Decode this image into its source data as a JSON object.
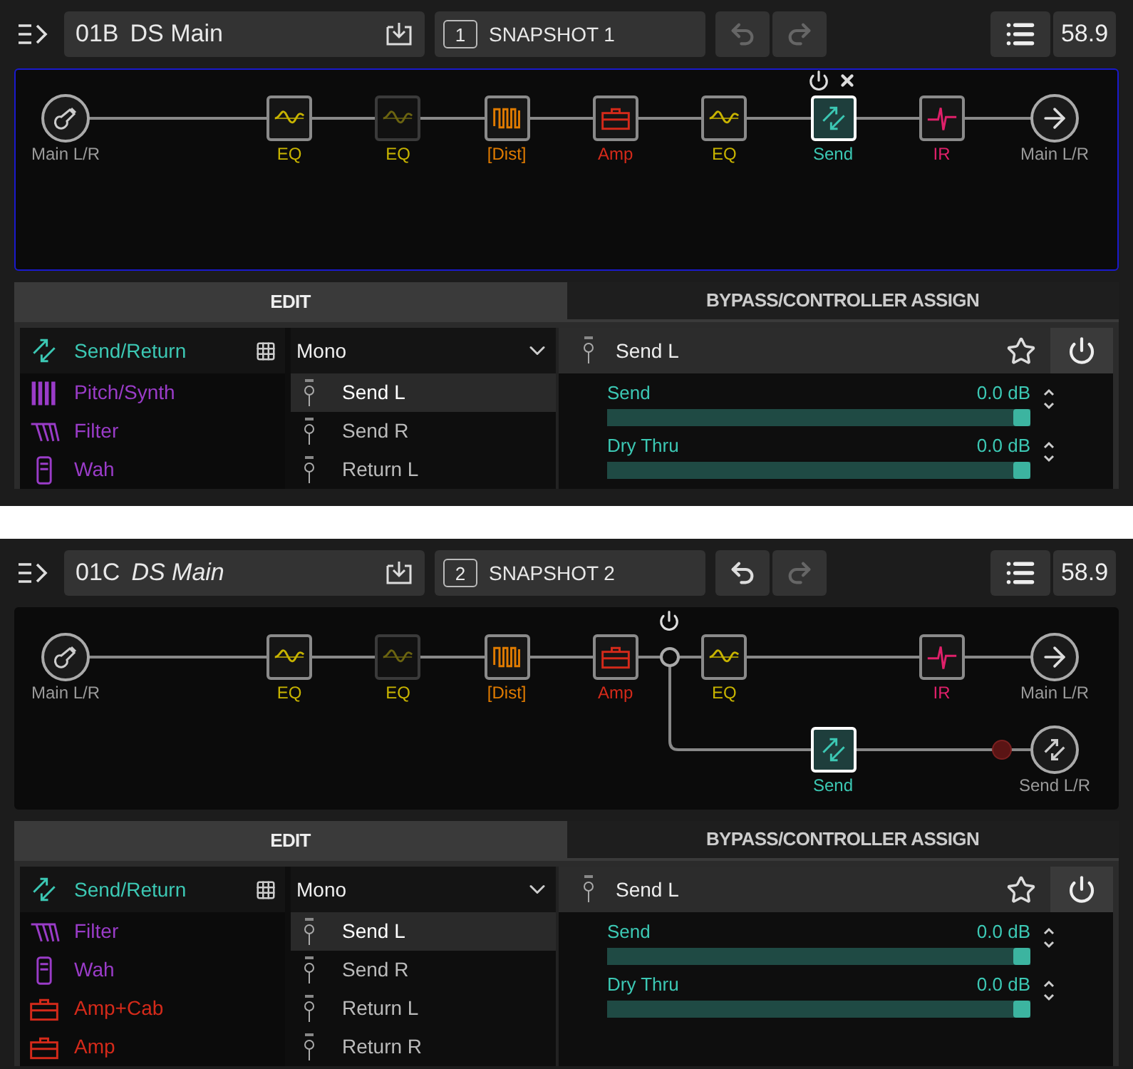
{
  "panels": [
    {
      "focused": true,
      "split": false,
      "header": {
        "preset_number": "01B",
        "preset_name": "DS Main",
        "edited": false,
        "snapshot_number": "1",
        "snapshot_label": "SNAPSHOT 1",
        "undo_enabled": false,
        "redo_enabled": false,
        "tempo": "58.9"
      },
      "chain": {
        "input": "Main L/R",
        "output": "Main L/R",
        "blocks": [
          {
            "kind": "eq",
            "label": "EQ",
            "color": "#c8b400",
            "bypassed": false,
            "selected": false
          },
          {
            "kind": "eq",
            "label": "EQ",
            "color": "#c8b400",
            "bypassed": true,
            "selected": false
          },
          {
            "kind": "dist",
            "label": "[Dist]",
            "color": "#e07b00",
            "bypassed": false,
            "selected": false
          },
          {
            "kind": "amp",
            "label": "Amp",
            "color": "#d42a1a",
            "bypassed": false,
            "selected": false
          },
          {
            "kind": "eq",
            "label": "EQ",
            "color": "#c8b400",
            "bypassed": false,
            "selected": false
          },
          {
            "kind": "send",
            "label": "Send",
            "color": "#3cc8b4",
            "bypassed": false,
            "selected": true
          },
          {
            "kind": "ir",
            "label": "IR",
            "color": "#e0206a",
            "bypassed": false,
            "selected": false
          }
        ]
      },
      "edit": {
        "tabs": [
          {
            "label": "EDIT",
            "selected": true
          },
          {
            "label": "BYPASS/CONTROLLER ASSIGN",
            "selected": false
          }
        ],
        "categories": [
          {
            "kind": "send",
            "label": "Send/Return",
            "color": "#3cc8b4",
            "selected": true
          },
          {
            "kind": "pitch",
            "label": "Pitch/Synth",
            "color": "#9a3cc8",
            "selected": false
          },
          {
            "kind": "filter",
            "label": "Filter",
            "color": "#9a3cc8",
            "selected": false
          },
          {
            "kind": "wah",
            "label": "Wah",
            "color": "#9a3cc8",
            "selected": false
          }
        ],
        "mode": "Mono",
        "models": [
          {
            "label": "Send L",
            "selected": true
          },
          {
            "label": "Send R",
            "selected": false
          },
          {
            "label": "Return L",
            "selected": false
          }
        ],
        "model_title": "Send L",
        "params": [
          {
            "label": "Send",
            "value": "0.0 dB",
            "level": 1
          },
          {
            "label": "Dry Thru",
            "value": "0.0 dB",
            "level": 1
          }
        ]
      }
    },
    {
      "focused": false,
      "split": true,
      "header": {
        "preset_number": "01C",
        "preset_name": "DS Main",
        "edited": true,
        "snapshot_number": "2",
        "snapshot_label": "SNAPSHOT 2",
        "undo_enabled": true,
        "redo_enabled": false,
        "tempo": "58.9"
      },
      "chain": {
        "input": "Main L/R",
        "output": "Main L/R",
        "branch_output": "Send L/R",
        "blocks": [
          {
            "kind": "eq",
            "label": "EQ",
            "color": "#c8b400",
            "bypassed": false,
            "selected": false
          },
          {
            "kind": "eq",
            "label": "EQ",
            "color": "#c8b400",
            "bypassed": true,
            "selected": false
          },
          {
            "kind": "dist",
            "label": "[Dist]",
            "color": "#e07b00",
            "bypassed": false,
            "selected": false
          },
          {
            "kind": "amp",
            "label": "Amp",
            "color": "#d42a1a",
            "bypassed": false,
            "selected": false
          },
          {
            "kind": "eq",
            "label": "EQ",
            "color": "#c8b400",
            "bypassed": false,
            "selected": false
          },
          {
            "kind": "ir",
            "label": "IR",
            "color": "#e0206a",
            "bypassed": false,
            "selected": false
          }
        ],
        "branch_blocks": [
          {
            "kind": "send",
            "label": "Send",
            "color": "#3cc8b4",
            "bypassed": false,
            "selected": true
          }
        ]
      },
      "edit": {
        "tabs": [
          {
            "label": "EDIT",
            "selected": true
          },
          {
            "label": "BYPASS/CONTROLLER ASSIGN",
            "selected": false
          }
        ],
        "categories": [
          {
            "kind": "send",
            "label": "Send/Return",
            "color": "#3cc8b4",
            "selected": true
          },
          {
            "kind": "filter",
            "label": "Filter",
            "color": "#9a3cc8",
            "selected": false
          },
          {
            "kind": "wah",
            "label": "Wah",
            "color": "#9a3cc8",
            "selected": false
          },
          {
            "kind": "ampcab",
            "label": "Amp+Cab",
            "color": "#d42a1a",
            "selected": false
          },
          {
            "kind": "amp",
            "label": "Amp",
            "color": "#d42a1a",
            "selected": false
          }
        ],
        "mode": "Mono",
        "models": [
          {
            "label": "Send L",
            "selected": true
          },
          {
            "label": "Send R",
            "selected": false
          },
          {
            "label": "Return L",
            "selected": false
          },
          {
            "label": "Return R",
            "selected": false
          }
        ],
        "model_title": "Send L",
        "params": [
          {
            "label": "Send",
            "value": "0.0 dB",
            "level": 1
          },
          {
            "label": "Dry Thru",
            "value": "0.0 dB",
            "level": 1
          }
        ]
      }
    }
  ]
}
